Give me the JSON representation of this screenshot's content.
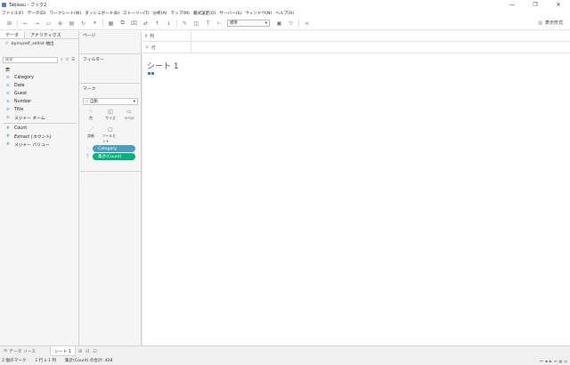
{
  "window": {
    "title": "Tableau - ブック2",
    "min": "—",
    "restore": "❐",
    "close": "✕"
  },
  "menu": [
    "ファイル(F)",
    "データ(D)",
    "ワークシート(W)",
    "ダッシュボード(B)",
    "ストーリー(T)",
    "分析(A)",
    "マップ(M)",
    "書式設定(O)",
    "サーバー(S)",
    "ウィンドウ(N)",
    "ヘルプ(H)"
  ],
  "toolbar": {
    "fit_value": "標準",
    "present_label": "表示形式"
  },
  "data_pane": {
    "tabs": [
      "データ",
      "アナリティクス"
    ],
    "datasource": "bymyself_setlist 抽出",
    "search_placeholder": "検索",
    "section_label": "表",
    "dimensions": [
      "Category",
      "Date",
      "Guest",
      "Number",
      "Title",
      "メジャー ネーム"
    ],
    "measures": [
      "Count",
      "Extract (カウント)",
      "メジャー バリュー"
    ]
  },
  "cards": {
    "pages": "ページ",
    "filters": "フィルター",
    "marks": "マーク",
    "mark_type": "自動",
    "mark_buttons": [
      "色",
      "サイズ",
      "ラベル",
      "詳細",
      "ツールヒント"
    ],
    "pills": [
      "Category",
      "集計(Count)"
    ]
  },
  "shelves": {
    "columns": "列",
    "rows": "行"
  },
  "viz": {
    "sheet_title": "シート 1"
  },
  "tabs": {
    "data_source": "データ ソース",
    "sheet": "シート 1"
  },
  "status": {
    "marks": "2 個のマーク",
    "rowscols": "1 行 x 1 列",
    "sum": "集計(Count) の合計: 428"
  }
}
